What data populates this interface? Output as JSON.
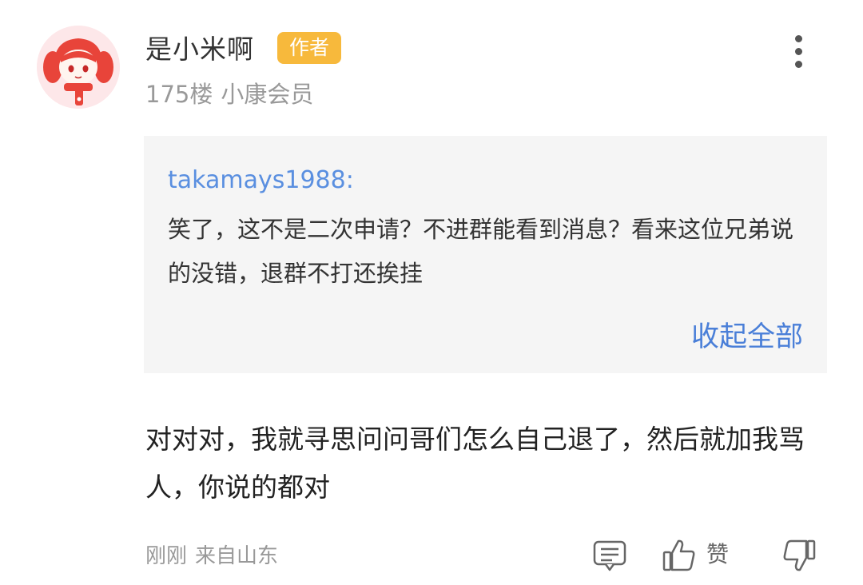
{
  "post": {
    "username": "是小米啊",
    "author_badge": "作者",
    "floor": "175楼",
    "member_level": "小康会员",
    "avatar_icon": "avatar-icon"
  },
  "quote": {
    "user": "takamays1988:",
    "text": "笑了，这不是二次申请？不进群能看到消息？看来这位兄弟说的没错，退群不打还挨挂",
    "collapse_label": "收起全部"
  },
  "comment": {
    "text": "对对对，我就寻思问问哥们怎么自己退了，然后就加我骂人，你说的都对"
  },
  "footer": {
    "time": "刚刚",
    "location": "来自山东",
    "like_label": "赞"
  },
  "colors": {
    "author_badge_bg": "#f7b93c",
    "link_blue": "#4a7fd8",
    "quote_bg": "#f5f5f5",
    "meta_gray": "#999999"
  },
  "icons": [
    "more-vertical-icon",
    "reply-icon",
    "thumbs-up-icon",
    "thumbs-down-icon"
  ]
}
